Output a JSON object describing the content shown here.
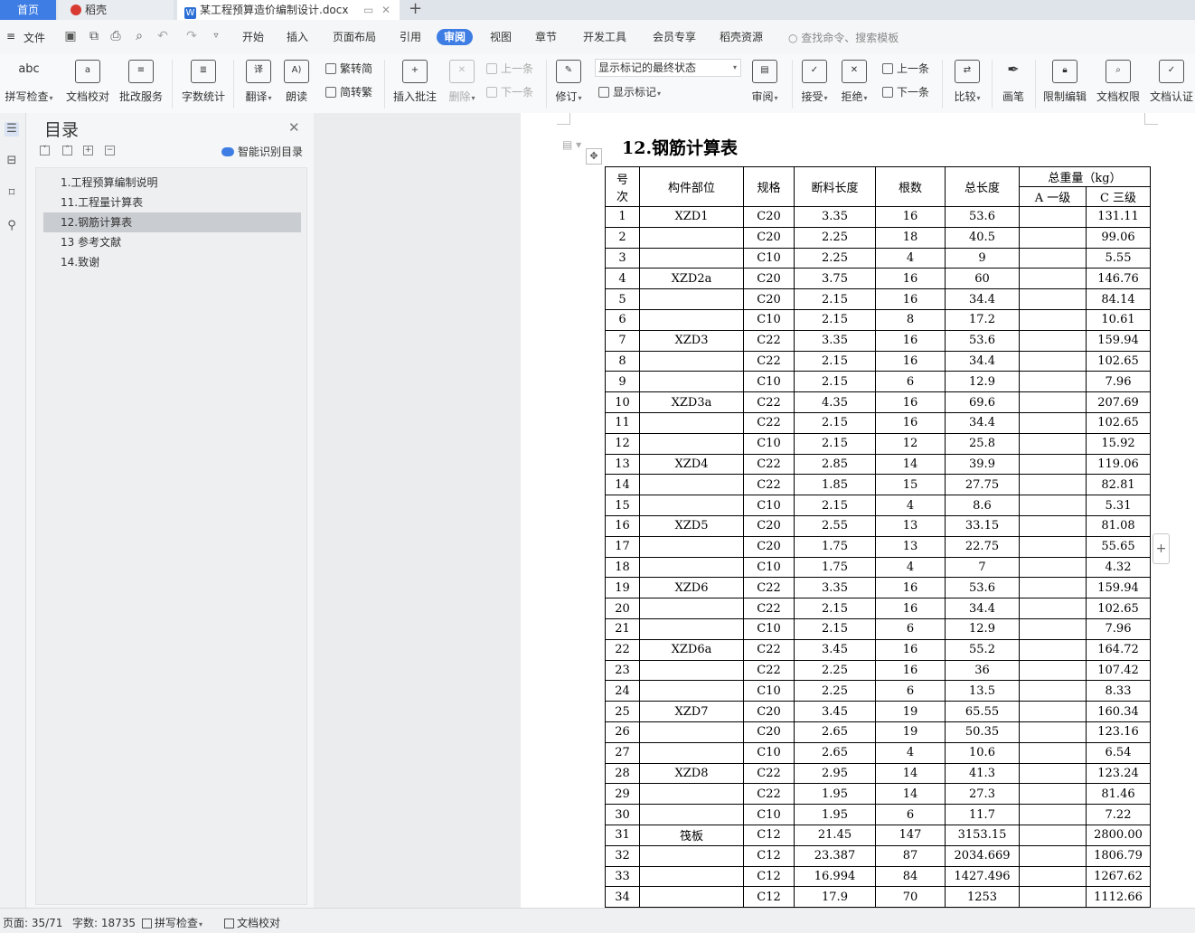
{
  "tabs": {
    "home": "首页",
    "daoke": "稻壳",
    "doc": "某工程预算造价编制设计.docx"
  },
  "menu": {
    "file": "文件",
    "tabs": [
      "开始",
      "插入",
      "页面布局",
      "引用",
      "审阅",
      "视图",
      "章节",
      "开发工具",
      "会员专享",
      "稻壳资源"
    ],
    "active_tab": "审阅",
    "search_placeholder": "查找命令、搜索模板"
  },
  "ribbon": {
    "spell_check": "拼写检查",
    "doc_proof": "文档校对",
    "revise_service": "批改服务",
    "word_count": "字数统计",
    "translate": "翻译",
    "read_aloud": "朗读",
    "trad_to_simp": "繁转简",
    "simp_to_trad": "简转繁",
    "insert_comment": "插入批注",
    "delete": "删除",
    "prev_comment": "上一条",
    "next_comment": "下一条",
    "track_changes": "修订",
    "display_mode": "显示标记的最终状态",
    "show_markup": "显示标记",
    "review": "审阅",
    "accept": "接受",
    "reject": "拒绝",
    "prev_change": "上一条",
    "next_change": "下一条",
    "compare": "比较",
    "pen": "画笔",
    "restrict_edit": "限制编辑",
    "doc_permission": "文档权限",
    "doc_certify": "文档认证"
  },
  "toc": {
    "title": "目录",
    "smart_detect": "智能识别目录",
    "items": [
      "1.工程预算编制说明",
      "11.工程量计算表",
      "12.钢筋计算表",
      "13 参考文献",
      "14.致谢"
    ],
    "selected_index": 2
  },
  "document": {
    "heading": "12.钢筋计算表",
    "table": {
      "headers": {
        "no_line1": "号",
        "no_line2": "次",
        "part": "构件部位",
        "spec": "规格",
        "cut_length": "断料长度",
        "count": "根数",
        "total_length": "总长度",
        "total_weight": "总重量（kg）",
        "grade_a": "A 一级",
        "grade_c": "C 三级"
      },
      "rows": [
        [
          "1",
          "XZD1",
          "C20",
          "3.35",
          "16",
          "53.6",
          "",
          "131.11"
        ],
        [
          "2",
          "",
          "C20",
          "2.25",
          "18",
          "40.5",
          "",
          "99.06"
        ],
        [
          "3",
          "",
          "C10",
          "2.25",
          "4",
          "9",
          "",
          "5.55"
        ],
        [
          "4",
          "XZD2a",
          "C20",
          "3.75",
          "16",
          "60",
          "",
          "146.76"
        ],
        [
          "5",
          "",
          "C20",
          "2.15",
          "16",
          "34.4",
          "",
          "84.14"
        ],
        [
          "6",
          "",
          "C10",
          "2.15",
          "8",
          "17.2",
          "",
          "10.61"
        ],
        [
          "7",
          "XZD3",
          "C22",
          "3.35",
          "16",
          "53.6",
          "",
          "159.94"
        ],
        [
          "8",
          "",
          "C22",
          "2.15",
          "16",
          "34.4",
          "",
          "102.65"
        ],
        [
          "9",
          "",
          "C10",
          "2.15",
          "6",
          "12.9",
          "",
          "7.96"
        ],
        [
          "10",
          "XZD3a",
          "C22",
          "4.35",
          "16",
          "69.6",
          "",
          "207.69"
        ],
        [
          "11",
          "",
          "C22",
          "2.15",
          "16",
          "34.4",
          "",
          "102.65"
        ],
        [
          "12",
          "",
          "C10",
          "2.15",
          "12",
          "25.8",
          "",
          "15.92"
        ],
        [
          "13",
          "XZD4",
          "C22",
          "2.85",
          "14",
          "39.9",
          "",
          "119.06"
        ],
        [
          "14",
          "",
          "C22",
          "1.85",
          "15",
          "27.75",
          "",
          "82.81"
        ],
        [
          "15",
          "",
          "C10",
          "2.15",
          "4",
          "8.6",
          "",
          "5.31"
        ],
        [
          "16",
          "XZD5",
          "C20",
          "2.55",
          "13",
          "33.15",
          "",
          "81.08"
        ],
        [
          "17",
          "",
          "C20",
          "1.75",
          "13",
          "22.75",
          "",
          "55.65"
        ],
        [
          "18",
          "",
          "C10",
          "1.75",
          "4",
          "7",
          "",
          "4.32"
        ],
        [
          "19",
          "XZD6",
          "C22",
          "3.35",
          "16",
          "53.6",
          "",
          "159.94"
        ],
        [
          "20",
          "",
          "C22",
          "2.15",
          "16",
          "34.4",
          "",
          "102.65"
        ],
        [
          "21",
          "",
          "C10",
          "2.15",
          "6",
          "12.9",
          "",
          "7.96"
        ],
        [
          "22",
          "XZD6a",
          "C22",
          "3.45",
          "16",
          "55.2",
          "",
          "164.72"
        ],
        [
          "23",
          "",
          "C22",
          "2.25",
          "16",
          "36",
          "",
          "107.42"
        ],
        [
          "24",
          "",
          "C10",
          "2.25",
          "6",
          "13.5",
          "",
          "8.33"
        ],
        [
          "25",
          "XZD7",
          "C20",
          "3.45",
          "19",
          "65.55",
          "",
          "160.34"
        ],
        [
          "26",
          "",
          "C20",
          "2.65",
          "19",
          "50.35",
          "",
          "123.16"
        ],
        [
          "27",
          "",
          "C10",
          "2.65",
          "4",
          "10.6",
          "",
          "6.54"
        ],
        [
          "28",
          "XZD8",
          "C22",
          "2.95",
          "14",
          "41.3",
          "",
          "123.24"
        ],
        [
          "29",
          "",
          "C22",
          "1.95",
          "14",
          "27.3",
          "",
          "81.46"
        ],
        [
          "30",
          "",
          "C10",
          "1.95",
          "6",
          "11.7",
          "",
          "7.22"
        ],
        [
          "31",
          "筏板",
          "C12",
          "21.45",
          "147",
          "3153.15",
          "",
          "2800.00"
        ],
        [
          "32",
          "",
          "C12",
          "23.387",
          "87",
          "2034.669",
          "",
          "1806.79"
        ],
        [
          "33",
          "",
          "C12",
          "16.994",
          "84",
          "1427.496",
          "",
          "1267.62"
        ],
        [
          "34",
          "",
          "C12",
          "17.9",
          "70",
          "1253",
          "",
          "1112.66"
        ]
      ]
    }
  },
  "status": {
    "page": "页面: 35/71",
    "word_count": "字数: 18735",
    "spell_check": "拼写检查",
    "doc_proof": "文档校对"
  },
  "colors": {
    "accent": "#3d7de4",
    "toc_selected": "#c9ccd1"
  }
}
